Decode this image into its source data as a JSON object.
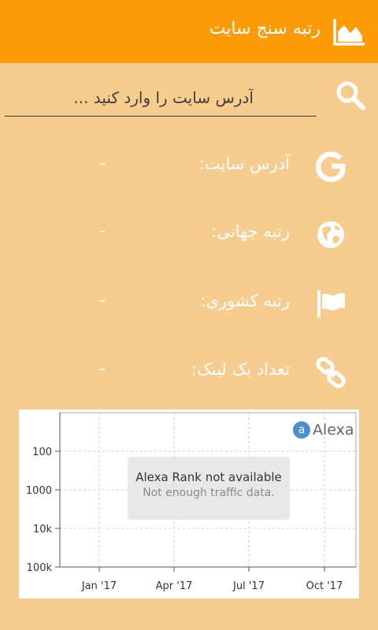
{
  "app_bar": {
    "title": "رتبه سنج سایت",
    "background": "#fd9a07",
    "logo_icon": "area-chart-icon"
  },
  "search": {
    "placeholder": "آدرس سایت را وارد کنید ...",
    "value": "",
    "icon": "search-icon"
  },
  "info_rows": [
    {
      "icon": "google-icon",
      "label": "آدرس سایت:",
      "value": "-"
    },
    {
      "icon": "globe-icon",
      "label": "رتبه جهانی:",
      "value": "-"
    },
    {
      "icon": "flag-icon",
      "label": "رتبه کشوری:",
      "value": "-"
    },
    {
      "icon": "link-icon",
      "label": "تعداد بک لینک:",
      "value": "-"
    }
  ],
  "chart": {
    "brand": "Alexa",
    "brand_letter": "a",
    "notice_title": "Alexa Rank not available",
    "notice_subtitle": "Not enough traffic data.",
    "y_ticks": [
      "100",
      "1000",
      "10k",
      "100k"
    ],
    "x_ticks": [
      "Jan '17",
      "Apr '17",
      "Jul '17",
      "Oct '17"
    ]
  },
  "colors": {
    "page_background": "#f6cc8f",
    "text": "#ffffff",
    "brand_blue": "#4a8fcf"
  }
}
